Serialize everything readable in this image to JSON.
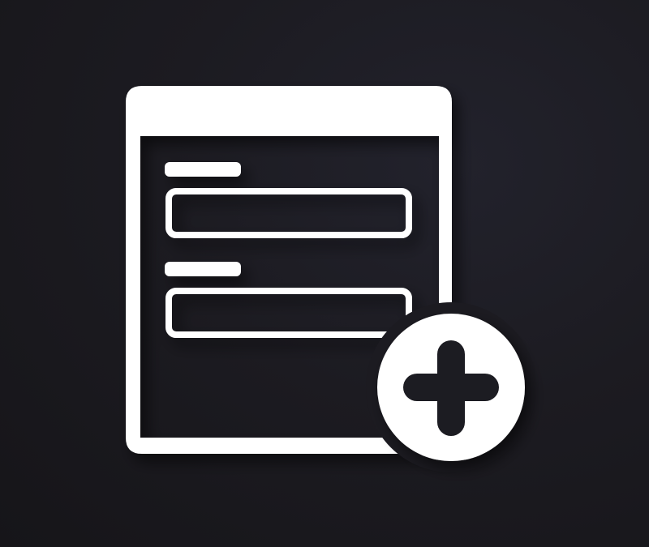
{
  "icon": {
    "name": "add-form-icon",
    "parts": [
      "form-document-icon",
      "plus-circle-icon"
    ]
  },
  "colors": {
    "background": "#1c1b21",
    "foreground": "#ffffff"
  }
}
